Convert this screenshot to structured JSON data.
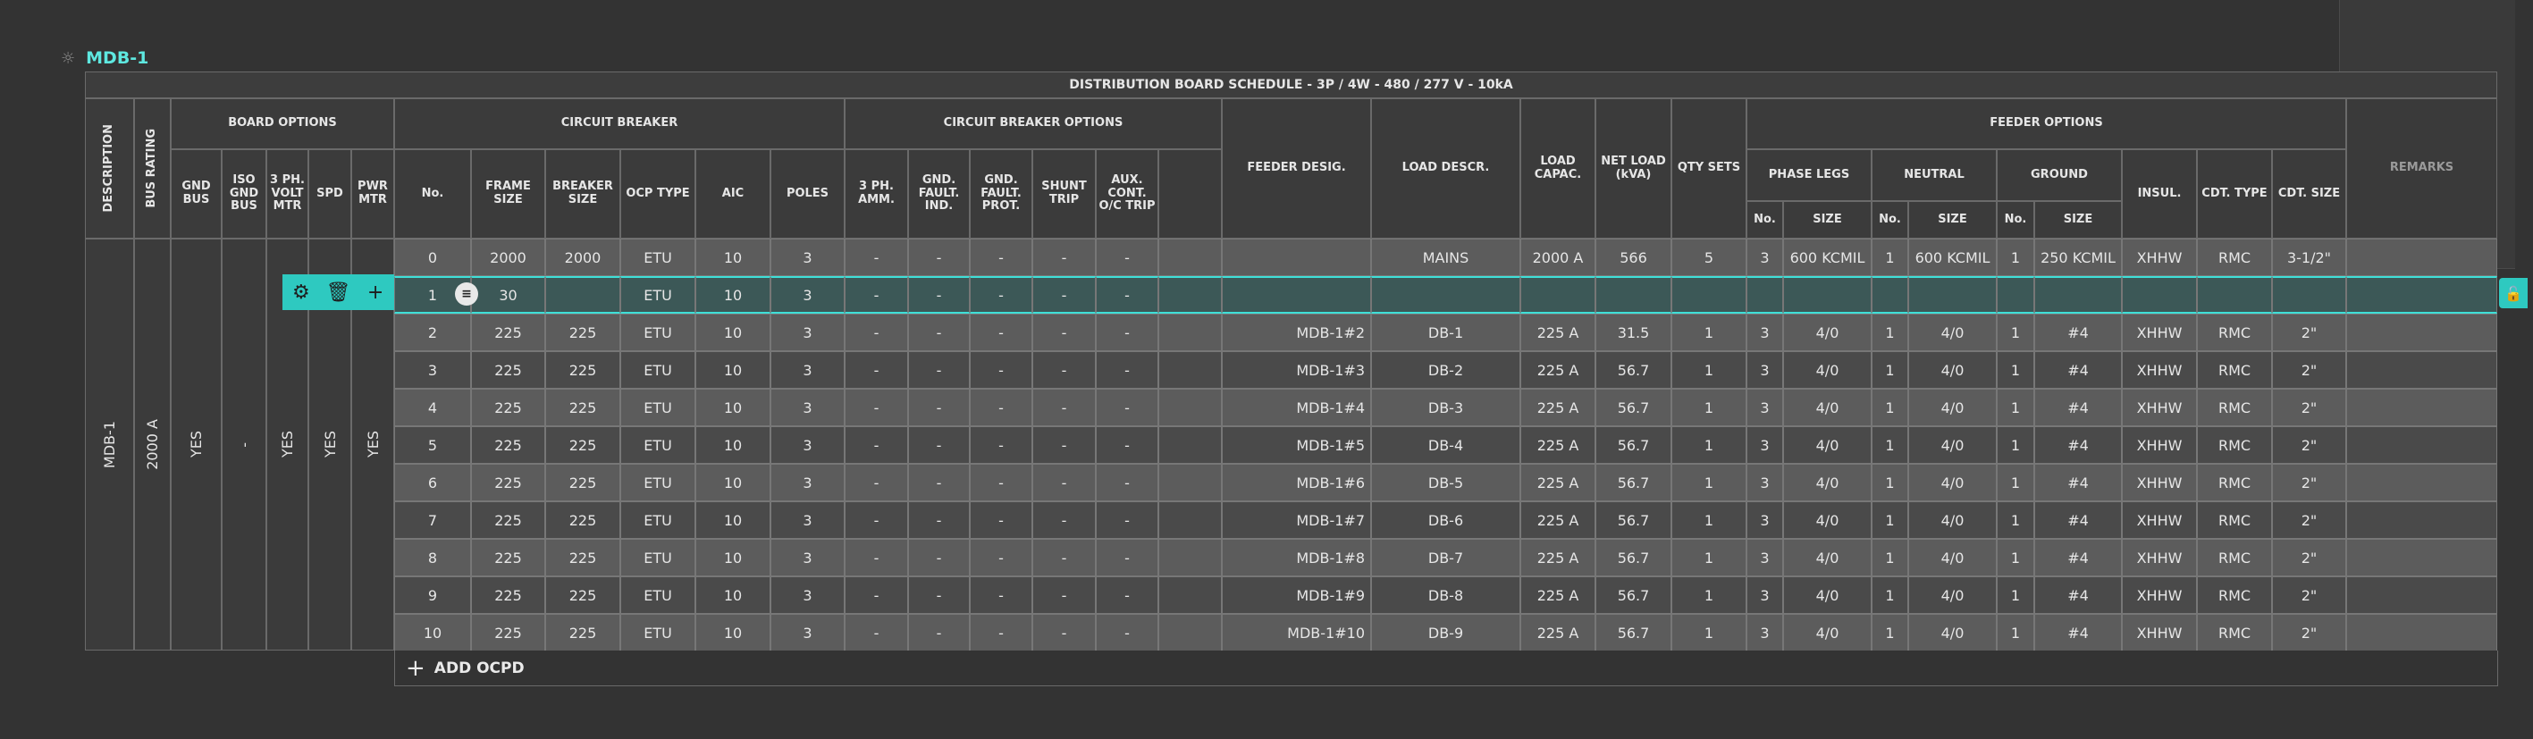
{
  "board": {
    "name": "MDB-1",
    "icon": "gear-icon"
  },
  "schedule_title": "DISTRIBUTION BOARD SCHEDULE - 3P / 4W - 480 / 277 V - 10kA",
  "headers": {
    "description": "DESCRIPTION",
    "bus_rating": "BUS RATING",
    "board_options": "BOARD OPTIONS",
    "gnd_bus": "GND BUS",
    "iso_gnd_bus": "ISO GND BUS",
    "volt_mtr": "3 PH. VOLT MTR",
    "spd": "SPD",
    "pwr_mtr": "PWR MTR",
    "circuit_breaker": "CIRCUIT BREAKER",
    "no": "No.",
    "frame_size": "FRAME SIZE",
    "breaker_size": "BREAKER SIZE",
    "ocp_type": "OCP TYPE",
    "aic": "AIC",
    "poles": "POLES",
    "cb_options": "CIRCUIT BREAKER OPTIONS",
    "amm": "3 PH. AMM.",
    "gfi": "GND. FAULT. IND.",
    "gfp": "GND. FAULT. PROT.",
    "shunt": "SHUNT TRIP",
    "aux": "AUX. CONT. O/C TRIP",
    "feeder_desig": "FEEDER DESIG.",
    "load_descr": "LOAD DESCR.",
    "load_capac": "LOAD CAPAC.",
    "net_load": "NET LOAD (kVA)",
    "qty_sets": "QTY SETS",
    "feeder_options": "FEEDER OPTIONS",
    "phase_legs": "PHASE LEGS",
    "neutral": "NEUTRAL",
    "ground": "GROUND",
    "sub_no": "No.",
    "sub_size": "SIZE",
    "insul": "INSUL.",
    "cdt_type": "CDT. TYPE",
    "cdt_size": "CDT. SIZE",
    "remarks": "REMARKS"
  },
  "board_values": {
    "description": "MDB-1",
    "bus_rating": "2000 A",
    "gnd_bus": "YES",
    "iso_gnd_bus": "-",
    "volt_mtr": "YES",
    "spd": "YES",
    "pwr_mtr": "YES"
  },
  "rows": [
    {
      "no": "0",
      "frame": "2000",
      "breaker": "2000",
      "ocp": "ETU",
      "aic": "10",
      "poles": "3",
      "amm": "-",
      "gfi": "-",
      "gfp": "-",
      "shunt": "-",
      "aux": "-",
      "feeder": "",
      "load": "MAINS",
      "capac": "2000 A",
      "net": "566",
      "qty": "5",
      "ph_no": "3",
      "ph_size": "600 KCMIL",
      "n_no": "1",
      "n_size": "600 KCMIL",
      "g_no": "1",
      "g_size": "250 KCMIL",
      "insul": "XHHW",
      "cdt_type": "RMC",
      "cdt_size": "3-1/2\"",
      "remarks": ""
    },
    {
      "no": "1",
      "frame": "30",
      "breaker": "",
      "ocp": "ETU",
      "aic": "10",
      "poles": "3",
      "amm": "-",
      "gfi": "-",
      "gfp": "-",
      "shunt": "-",
      "aux": "-",
      "feeder": "",
      "load": "",
      "capac": "",
      "net": "",
      "qty": "",
      "ph_no": "",
      "ph_size": "",
      "n_no": "",
      "n_size": "",
      "g_no": "",
      "g_size": "",
      "insul": "",
      "cdt_type": "",
      "cdt_size": "",
      "remarks": ""
    },
    {
      "no": "2",
      "frame": "225",
      "breaker": "225",
      "ocp": "ETU",
      "aic": "10",
      "poles": "3",
      "amm": "-",
      "gfi": "-",
      "gfp": "-",
      "shunt": "-",
      "aux": "-",
      "feeder": "MDB-1#2",
      "load": "DB-1",
      "capac": "225 A",
      "net": "31.5",
      "qty": "1",
      "ph_no": "3",
      "ph_size": "4/0",
      "n_no": "1",
      "n_size": "4/0",
      "g_no": "1",
      "g_size": "#4",
      "insul": "XHHW",
      "cdt_type": "RMC",
      "cdt_size": "2\"",
      "remarks": ""
    },
    {
      "no": "3",
      "frame": "225",
      "breaker": "225",
      "ocp": "ETU",
      "aic": "10",
      "poles": "3",
      "amm": "-",
      "gfi": "-",
      "gfp": "-",
      "shunt": "-",
      "aux": "-",
      "feeder": "MDB-1#3",
      "load": "DB-2",
      "capac": "225 A",
      "net": "56.7",
      "qty": "1",
      "ph_no": "3",
      "ph_size": "4/0",
      "n_no": "1",
      "n_size": "4/0",
      "g_no": "1",
      "g_size": "#4",
      "insul": "XHHW",
      "cdt_type": "RMC",
      "cdt_size": "2\"",
      "remarks": ""
    },
    {
      "no": "4",
      "frame": "225",
      "breaker": "225",
      "ocp": "ETU",
      "aic": "10",
      "poles": "3",
      "amm": "-",
      "gfi": "-",
      "gfp": "-",
      "shunt": "-",
      "aux": "-",
      "feeder": "MDB-1#4",
      "load": "DB-3",
      "capac": "225 A",
      "net": "56.7",
      "qty": "1",
      "ph_no": "3",
      "ph_size": "4/0",
      "n_no": "1",
      "n_size": "4/0",
      "g_no": "1",
      "g_size": "#4",
      "insul": "XHHW",
      "cdt_type": "RMC",
      "cdt_size": "2\"",
      "remarks": ""
    },
    {
      "no": "5",
      "frame": "225",
      "breaker": "225",
      "ocp": "ETU",
      "aic": "10",
      "poles": "3",
      "amm": "-",
      "gfi": "-",
      "gfp": "-",
      "shunt": "-",
      "aux": "-",
      "feeder": "MDB-1#5",
      "load": "DB-4",
      "capac": "225 A",
      "net": "56.7",
      "qty": "1",
      "ph_no": "3",
      "ph_size": "4/0",
      "n_no": "1",
      "n_size": "4/0",
      "g_no": "1",
      "g_size": "#4",
      "insul": "XHHW",
      "cdt_type": "RMC",
      "cdt_size": "2\"",
      "remarks": ""
    },
    {
      "no": "6",
      "frame": "225",
      "breaker": "225",
      "ocp": "ETU",
      "aic": "10",
      "poles": "3",
      "amm": "-",
      "gfi": "-",
      "gfp": "-",
      "shunt": "-",
      "aux": "-",
      "feeder": "MDB-1#6",
      "load": "DB-5",
      "capac": "225 A",
      "net": "56.7",
      "qty": "1",
      "ph_no": "3",
      "ph_size": "4/0",
      "n_no": "1",
      "n_size": "4/0",
      "g_no": "1",
      "g_size": "#4",
      "insul": "XHHW",
      "cdt_type": "RMC",
      "cdt_size": "2\"",
      "remarks": ""
    },
    {
      "no": "7",
      "frame": "225",
      "breaker": "225",
      "ocp": "ETU",
      "aic": "10",
      "poles": "3",
      "amm": "-",
      "gfi": "-",
      "gfp": "-",
      "shunt": "-",
      "aux": "-",
      "feeder": "MDB-1#7",
      "load": "DB-6",
      "capac": "225 A",
      "net": "56.7",
      "qty": "1",
      "ph_no": "3",
      "ph_size": "4/0",
      "n_no": "1",
      "n_size": "4/0",
      "g_no": "1",
      "g_size": "#4",
      "insul": "XHHW",
      "cdt_type": "RMC",
      "cdt_size": "2\"",
      "remarks": ""
    },
    {
      "no": "8",
      "frame": "225",
      "breaker": "225",
      "ocp": "ETU",
      "aic": "10",
      "poles": "3",
      "amm": "-",
      "gfi": "-",
      "gfp": "-",
      "shunt": "-",
      "aux": "-",
      "feeder": "MDB-1#8",
      "load": "DB-7",
      "capac": "225 A",
      "net": "56.7",
      "qty": "1",
      "ph_no": "3",
      "ph_size": "4/0",
      "n_no": "1",
      "n_size": "4/0",
      "g_no": "1",
      "g_size": "#4",
      "insul": "XHHW",
      "cdt_type": "RMC",
      "cdt_size": "2\"",
      "remarks": ""
    },
    {
      "no": "9",
      "frame": "225",
      "breaker": "225",
      "ocp": "ETU",
      "aic": "10",
      "poles": "3",
      "amm": "-",
      "gfi": "-",
      "gfp": "-",
      "shunt": "-",
      "aux": "-",
      "feeder": "MDB-1#9",
      "load": "DB-8",
      "capac": "225 A",
      "net": "56.7",
      "qty": "1",
      "ph_no": "3",
      "ph_size": "4/0",
      "n_no": "1",
      "n_size": "4/0",
      "g_no": "1",
      "g_size": "#4",
      "insul": "XHHW",
      "cdt_type": "RMC",
      "cdt_size": "2\"",
      "remarks": ""
    },
    {
      "no": "10",
      "frame": "225",
      "breaker": "225",
      "ocp": "ETU",
      "aic": "10",
      "poles": "3",
      "amm": "-",
      "gfi": "-",
      "gfp": "-",
      "shunt": "-",
      "aux": "-",
      "feeder": "MDB-1#10",
      "load": "DB-9",
      "capac": "225 A",
      "net": "56.7",
      "qty": "1",
      "ph_no": "3",
      "ph_size": "4/0",
      "n_no": "1",
      "n_size": "4/0",
      "g_no": "1",
      "g_size": "#4",
      "insul": "XHHW",
      "cdt_type": "RMC",
      "cdt_size": "2\"",
      "remarks": ""
    }
  ],
  "selected_row_toolbar": {
    "settings_icon": "gear-icon",
    "delete_icon": "trash-icon",
    "add_icon": "plus-icon",
    "menu_icon": "menu-icon",
    "unlock_icon": "unlock-icon"
  },
  "add_ocpd_label": "ADD OCPD",
  "colors": {
    "accent": "#3ee0d8",
    "background": "#333333",
    "row_light": "#5c5c5c",
    "row_dark": "#4a4a4a"
  }
}
